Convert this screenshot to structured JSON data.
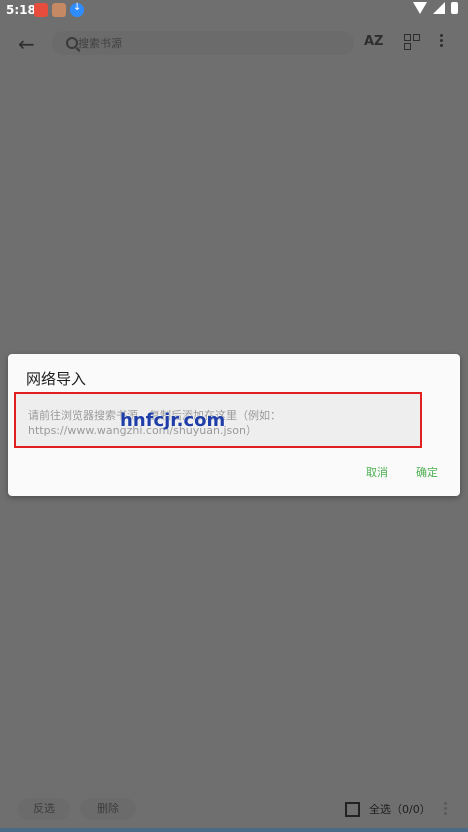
{
  "status_bar": {
    "time": "5:18"
  },
  "top_bar": {
    "search_placeholder": "搜索书源",
    "sort_label": "AZ"
  },
  "dialog": {
    "title": "网络导入",
    "input_placeholder": "请前往浏览器搜索书源，复制后添加在这里（例如：https://www.wangzhi.com/shuyuan.json）",
    "watermark": "hnfcjr.com",
    "cancel_label": "取消",
    "ok_label": "确定"
  },
  "bottom_bar": {
    "invert_label": "反选",
    "delete_label": "删除",
    "select_all_label": "全选（0/0）"
  }
}
